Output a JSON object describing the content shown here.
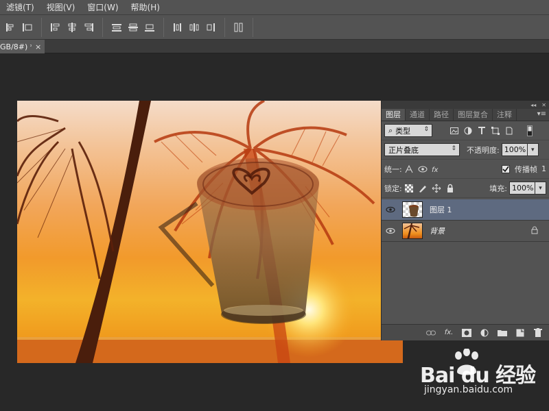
{
  "menubar": {
    "items": [
      "滤镜(T)",
      "视图(V)",
      "窗口(W)",
      "帮助(H)"
    ]
  },
  "optionsbar": {
    "icons": [
      "align-left-edges-icon",
      "align-h-centers-icon",
      "align-top-edges-icon",
      "align-v-centers-icon",
      "align-bottom-edges-icon",
      "align-right-edges-icon",
      "distribute-top-icon",
      "distribute-v-centers-icon",
      "distribute-bottom-icon",
      "distribute-left-icon",
      "distribute-h-centers-icon",
      "distribute-right-icon",
      "auto-align-icon"
    ]
  },
  "document": {
    "tab_title": "GB/8#) *",
    "close": "×"
  },
  "panel": {
    "top_controls": [
      "◂◂",
      "✕"
    ],
    "tabs": [
      "图层",
      "通道",
      "路径",
      "图层复合",
      "注释"
    ],
    "menu_icon": "▾≡",
    "filter": {
      "kind_label": "类型",
      "search_glyph": "⌕"
    },
    "blend": {
      "mode": "正片叠底",
      "opacity_label": "不透明度:",
      "opacity_value": "100%"
    },
    "unify": {
      "label": "统一:",
      "propagate_label": "传播帧",
      "propagate_value": "1",
      "propagate_checked": true
    },
    "lock": {
      "label": "锁定:",
      "fill_label": "填充:",
      "fill_value": "100%"
    },
    "layers": [
      {
        "name": "图层 1",
        "selected": true,
        "italic": false,
        "locked": false
      },
      {
        "name": "背景",
        "selected": false,
        "italic": true,
        "locked": true
      }
    ],
    "bottom_icons": [
      "link-icon",
      "fx-icon",
      "mask-icon",
      "adjustment-icon",
      "folder-icon",
      "new-layer-icon",
      "trash-icon"
    ],
    "fx_text": "fx."
  },
  "watermark": {
    "brand": "Bai du 经验",
    "site": "jingyan.baidu.com"
  },
  "colors": {
    "ui_bg": "#535353",
    "canvas_bg": "#282828",
    "selected_layer": "#5e6a80"
  }
}
